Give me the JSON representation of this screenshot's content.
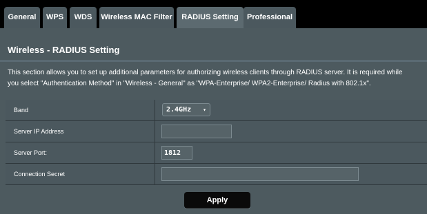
{
  "tabs": [
    {
      "label": "General"
    },
    {
      "label": "WPS"
    },
    {
      "label": "WDS"
    },
    {
      "label": "Wireless MAC Filter"
    },
    {
      "label": "RADIUS Setting",
      "active": true
    },
    {
      "label": "Professional"
    }
  ],
  "page": {
    "title": "Wireless - RADIUS Setting",
    "description_line1": "This section allows you to set up additional parameters for authorizing wireless clients through RADIUS server. It is required while",
    "description_line2": "you select \"Authentication Method\" in \"Wireless - General\" as \"WPA-Enterprise/ WPA2-Enterprise/ Radius with 802.1x\"."
  },
  "form": {
    "band": {
      "label": "Band",
      "value": "2.4GHz",
      "caret": "▲▼"
    },
    "server_ip": {
      "label": "Server IP Address",
      "value": ""
    },
    "server_port": {
      "label": "Server Port:",
      "value": "1812"
    },
    "connection_secret": {
      "label": "Connection Secret",
      "value": ""
    }
  },
  "actions": {
    "apply_label": "Apply"
  },
  "colors": {
    "background": "#4d5a5f",
    "tabbar": "#000000",
    "active_tab": "#5c6a70"
  }
}
